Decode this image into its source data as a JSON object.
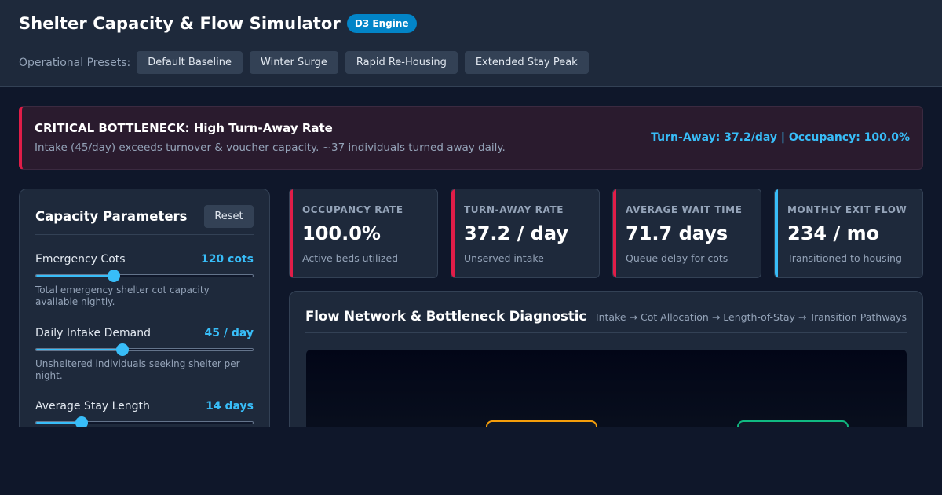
{
  "header": {
    "title": "Shelter Capacity & Flow Simulator",
    "badge": "D3 Engine",
    "presets_label": "Operational Presets:",
    "presets": [
      "Default Baseline",
      "Winter Surge",
      "Rapid Re-Housing",
      "Extended Stay Peak"
    ]
  },
  "alert": {
    "title": "CRITICAL BOTTLENECK: High Turn-Away Rate",
    "description": "Intake (45/day) exceeds turnover & voucher capacity. ~37 individuals turned away daily.",
    "metrics": "Turn-Away: 37.2/day | Occupancy: 100.0%",
    "color": "#e11d48"
  },
  "parameters": {
    "title": "Capacity Parameters",
    "reset_label": "Reset",
    "items": [
      {
        "name": "Emergency Cots",
        "value": "120 cots",
        "level": 0.36,
        "help": "Total emergency shelter cot capacity available nightly."
      },
      {
        "name": "Daily Intake Demand",
        "value": "45 / day",
        "level": 0.4,
        "help": "Unsheltered individuals seeking shelter per night."
      },
      {
        "name": "Average Stay Length",
        "value": "14 days",
        "level": 0.21,
        "help": ""
      }
    ]
  },
  "kpis": [
    {
      "label": "OCCUPANCY RATE",
      "value": "100.0%",
      "sub": "Active beds utilized",
      "color": "#e11d48"
    },
    {
      "label": "TURN-AWAY RATE",
      "value": "37.2 / day",
      "sub": "Unserved intake",
      "color": "#e11d48"
    },
    {
      "label": "AVERAGE WAIT TIME",
      "value": "71.7 days",
      "sub": "Queue delay for cots",
      "color": "#e11d48"
    },
    {
      "label": "MONTHLY EXIT FLOW",
      "value": "234 / mo",
      "sub": "Transitioned to housing",
      "color": "#38bdf8"
    }
  ],
  "flow": {
    "title": "Flow Network & Bottleneck Diagnostic",
    "path": "Intake → Cot Allocation → Length-of-Stay → Transition Pathways",
    "node_colors": [
      "#f59e0b",
      "#10b981"
    ]
  },
  "colors": {
    "accent": "#38bdf8",
    "critical": "#e11d48",
    "badge": "#0284c7"
  }
}
